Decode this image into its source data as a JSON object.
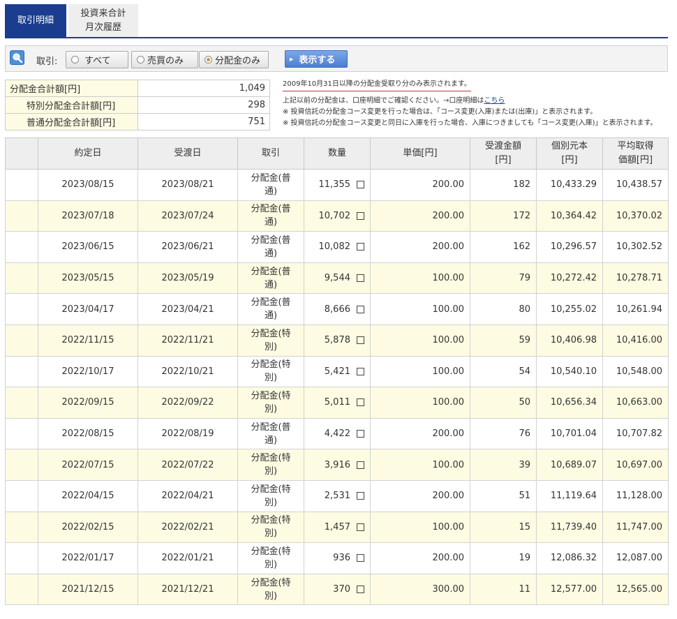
{
  "tabs": {
    "active": "取引明細",
    "inactive_line1": "投資来合計",
    "inactive_line2": "月次履歴"
  },
  "filter": {
    "label": "取引:",
    "options": [
      "すべて",
      "売買のみ",
      "分配金のみ"
    ],
    "selected": "分配金のみ",
    "show_button": "表示する"
  },
  "summary": {
    "rows": [
      {
        "label": "分配金合計額[円]",
        "value": "1,049"
      },
      {
        "label": "特別分配金合計額[円]",
        "value": "298"
      },
      {
        "label": "普通分配金合計額[円]",
        "value": "751"
      }
    ]
  },
  "notes": {
    "main": "2009年10月31日以降の分配金受取り分のみ表示されます。",
    "line1_text": "上記以前の分配金は、口座明細でご確認ください。→口座明細は",
    "line1_link": "こちら",
    "note2": "※ 投資信託の分配金コース変更を行った場合は、「コース変更(入庫)または(出庫)」と表示されます。",
    "note3": "※ 投資信託の分配金コース変更と同日に入庫を行った場合、入庫につきましても「コース変更(入庫)」と表示されます。"
  },
  "table": {
    "headers": {
      "trade_date": "約定日",
      "settle_date": "受渡日",
      "type": "取引",
      "qty": "数量",
      "price_1": "単価[円]",
      "amount_1": "受渡金額",
      "amount_2": "[円]",
      "principal_1": "個別元本",
      "principal_2": "[円]",
      "avg_1": "平均取得",
      "avg_2": "価額[円]"
    },
    "rows": [
      {
        "trade": "2023/08/15",
        "settle": "2023/08/21",
        "type1": "分配金(普",
        "type2": "通)",
        "qty": "11,355",
        "price": "200.00",
        "amount": "182",
        "principal": "10,433.29",
        "avg": "10,438.57"
      },
      {
        "trade": "2023/07/18",
        "settle": "2023/07/24",
        "type1": "分配金(普",
        "type2": "通)",
        "qty": "10,702",
        "price": "200.00",
        "amount": "172",
        "principal": "10,364.42",
        "avg": "10,370.02"
      },
      {
        "trade": "2023/06/15",
        "settle": "2023/06/21",
        "type1": "分配金(普",
        "type2": "通)",
        "qty": "10,082",
        "price": "200.00",
        "amount": "162",
        "principal": "10,296.57",
        "avg": "10,302.52"
      },
      {
        "trade": "2023/05/15",
        "settle": "2023/05/19",
        "type1": "分配金(普",
        "type2": "通)",
        "qty": "9,544",
        "price": "100.00",
        "amount": "79",
        "principal": "10,272.42",
        "avg": "10,278.71"
      },
      {
        "trade": "2023/04/17",
        "settle": "2023/04/21",
        "type1": "分配金(普",
        "type2": "通)",
        "qty": "8,666",
        "price": "100.00",
        "amount": "80",
        "principal": "10,255.02",
        "avg": "10,261.94"
      },
      {
        "trade": "2022/11/15",
        "settle": "2022/11/21",
        "type1": "分配金(特",
        "type2": "別)",
        "qty": "5,878",
        "price": "100.00",
        "amount": "59",
        "principal": "10,406.98",
        "avg": "10,416.00"
      },
      {
        "trade": "2022/10/17",
        "settle": "2022/10/21",
        "type1": "分配金(特",
        "type2": "別)",
        "qty": "5,421",
        "price": "100.00",
        "amount": "54",
        "principal": "10,540.10",
        "avg": "10,548.00"
      },
      {
        "trade": "2022/09/15",
        "settle": "2022/09/22",
        "type1": "分配金(特",
        "type2": "別)",
        "qty": "5,011",
        "price": "100.00",
        "amount": "50",
        "principal": "10,656.34",
        "avg": "10,663.00"
      },
      {
        "trade": "2022/08/15",
        "settle": "2022/08/19",
        "type1": "分配金(普",
        "type2": "通)",
        "qty": "4,422",
        "price": "200.00",
        "amount": "76",
        "principal": "10,701.04",
        "avg": "10,707.82"
      },
      {
        "trade": "2022/07/15",
        "settle": "2022/07/22",
        "type1": "分配金(特",
        "type2": "別)",
        "qty": "3,916",
        "price": "100.00",
        "amount": "39",
        "principal": "10,689.07",
        "avg": "10,697.00"
      },
      {
        "trade": "2022/04/15",
        "settle": "2022/04/21",
        "type1": "分配金(特",
        "type2": "別)",
        "qty": "2,531",
        "price": "200.00",
        "amount": "51",
        "principal": "11,119.64",
        "avg": "11,128.00"
      },
      {
        "trade": "2022/02/15",
        "settle": "2022/02/21",
        "type1": "分配金(特",
        "type2": "別)",
        "qty": "1,457",
        "price": "100.00",
        "amount": "15",
        "principal": "11,739.40",
        "avg": "11,747.00"
      },
      {
        "trade": "2022/01/17",
        "settle": "2022/01/21",
        "type1": "分配金(特",
        "type2": "別)",
        "qty": "936",
        "price": "200.00",
        "amount": "19",
        "principal": "12,086.32",
        "avg": "12,087.00"
      },
      {
        "trade": "2021/12/15",
        "settle": "2021/12/21",
        "type1": "分配金(特",
        "type2": "別)",
        "qty": "370",
        "price": "300.00",
        "amount": "11",
        "principal": "12,577.00",
        "avg": "12,565.00"
      }
    ]
  }
}
